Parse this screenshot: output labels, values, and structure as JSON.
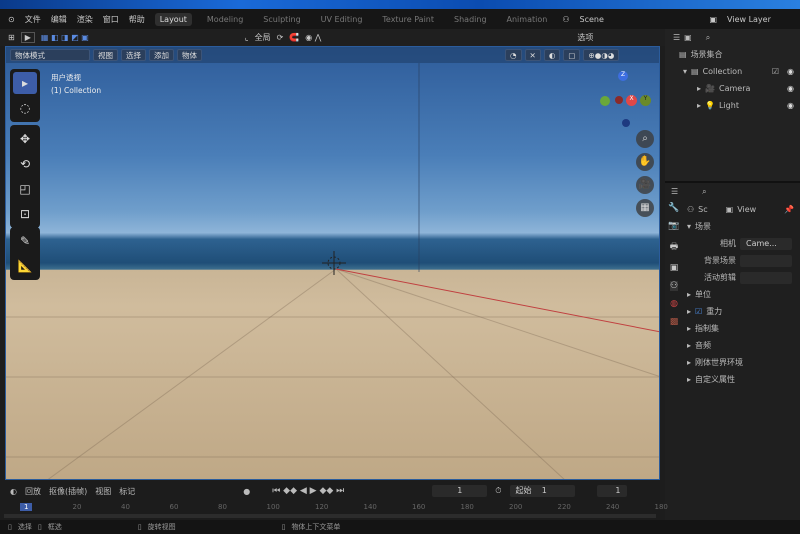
{
  "menu": {
    "items": [
      "文件",
      "编辑",
      "渲染",
      "窗口",
      "帮助"
    ],
    "workspaces": [
      "Layout",
      "Modeling",
      "Sculpting",
      "UV Editing",
      "Texture Paint",
      "Shading",
      "Animation"
    ],
    "active_workspace": "Layout",
    "scene": "Scene",
    "view_layer": "View Layer"
  },
  "tool_header": {
    "transform": "全局",
    "options": "选项"
  },
  "viewport": {
    "mode": "物体模式",
    "menus": [
      "视图",
      "选择",
      "添加",
      "物体"
    ],
    "view_name": "用户透视",
    "collection": "(1) Collection",
    "axes": {
      "z": "Z",
      "x": "X",
      "y": "Y"
    },
    "colors": {
      "x": "#e04848",
      "y": "#6aa83a",
      "z": "#3d6ee0"
    }
  },
  "outliner": {
    "root": "场景集合",
    "collection": "Collection",
    "items": [
      "Camera",
      "Light"
    ]
  },
  "properties": {
    "tabs": [
      "Sc",
      "View"
    ],
    "section": "场景",
    "fields": [
      {
        "label": "相机",
        "value": "Came..."
      },
      {
        "label": "背景场景",
        "value": ""
      },
      {
        "label": "活动剪辑",
        "value": ""
      }
    ],
    "panels": [
      "单位",
      "重力",
      "指制集",
      "音频",
      "刚体世界环境",
      "自定义属性"
    ],
    "gravity_checked": true
  },
  "timeline": {
    "menus": [
      "回放",
      "抠像(插帧)",
      "视图",
      "标记"
    ],
    "current_frame": "1",
    "start_label": "起始",
    "start": "1",
    "end": "1",
    "ticks": [
      "1",
      "20",
      "40",
      "60",
      "80",
      "100",
      "120",
      "140",
      "160",
      "180",
      "200",
      "220",
      "240",
      "180"
    ]
  },
  "status": {
    "items": [
      "选择",
      "框选",
      "旋转视图",
      "物体上下文菜单"
    ]
  }
}
